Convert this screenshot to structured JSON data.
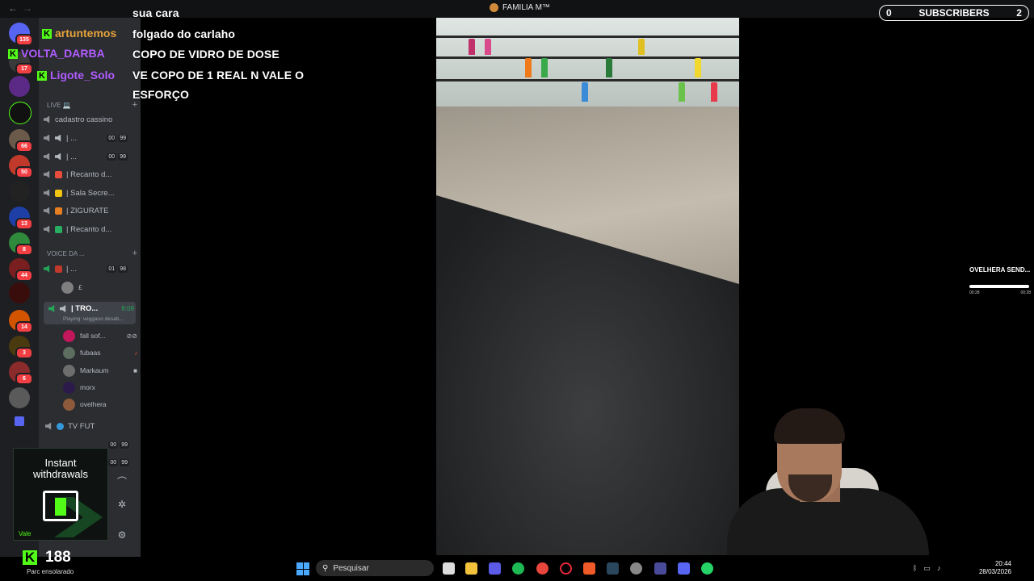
{
  "window": {
    "title": "FAMILIA M™"
  },
  "subscribers": {
    "left_count": "0",
    "label": "SUBSCRIBERS",
    "right_count": "2"
  },
  "chat": {
    "users": [
      {
        "name": "artuntemos",
        "color": "#e5a23a"
      },
      {
        "name": "VOLTA_DARBA",
        "color": "#b05cff"
      },
      {
        "name": "Ligote_Solo",
        "color": "#b05cff"
      }
    ],
    "messages": [
      "sua cara",
      "folgado do carlaho",
      "COPO DE VIDRO DE DOSE",
      "VE COPO DE 1 REAL N VALE O",
      "ESFORÇO"
    ]
  },
  "rail_badges": [
    "135",
    "17",
    "66",
    "50",
    "13",
    "8",
    "44",
    "14",
    "3",
    "6"
  ],
  "channels": {
    "cat_live": "LIVE 💻",
    "cat_voice": "VOICE DA ...",
    "items": [
      {
        "label": "cadastro cassino"
      },
      {
        "label": "| ...",
        "c1": "00",
        "c2": "99"
      },
      {
        "label": "| ...",
        "c1": "00",
        "c2": "99"
      },
      {
        "label": "| Recanto d..."
      },
      {
        "label": "| Sala Secre..."
      },
      {
        "label": "| ZIGURATE"
      },
      {
        "label": "| Recanto d..."
      }
    ],
    "voice_item": {
      "label": "| ...",
      "c1": "01",
      "c2": "98"
    },
    "voice_user": "£",
    "active": {
      "label": "| TRO...",
      "time": "8:09",
      "playing": "Playing: veggano desab..."
    },
    "members": [
      "fall sof...",
      "fubaas",
      "Markaum",
      "morx",
      "ovelhera"
    ],
    "tvfut": "TV FUT",
    "bottom_counts": [
      {
        "c1": "00",
        "c2": "99"
      },
      {
        "c1": "00",
        "c2": "99"
      }
    ]
  },
  "now_playing": {
    "title": "OVELHERA SEND...",
    "elapsed": "00:28",
    "total": "00:28"
  },
  "promo": {
    "line1": "Instant",
    "line2": "withdrawals",
    "tag": "Vale"
  },
  "kick": {
    "viewers": "188"
  },
  "weather": "Parc ensolarado",
  "taskbar": {
    "search_placeholder": "Pesquisar",
    "time": "20:44",
    "date": "28/03/2026"
  }
}
